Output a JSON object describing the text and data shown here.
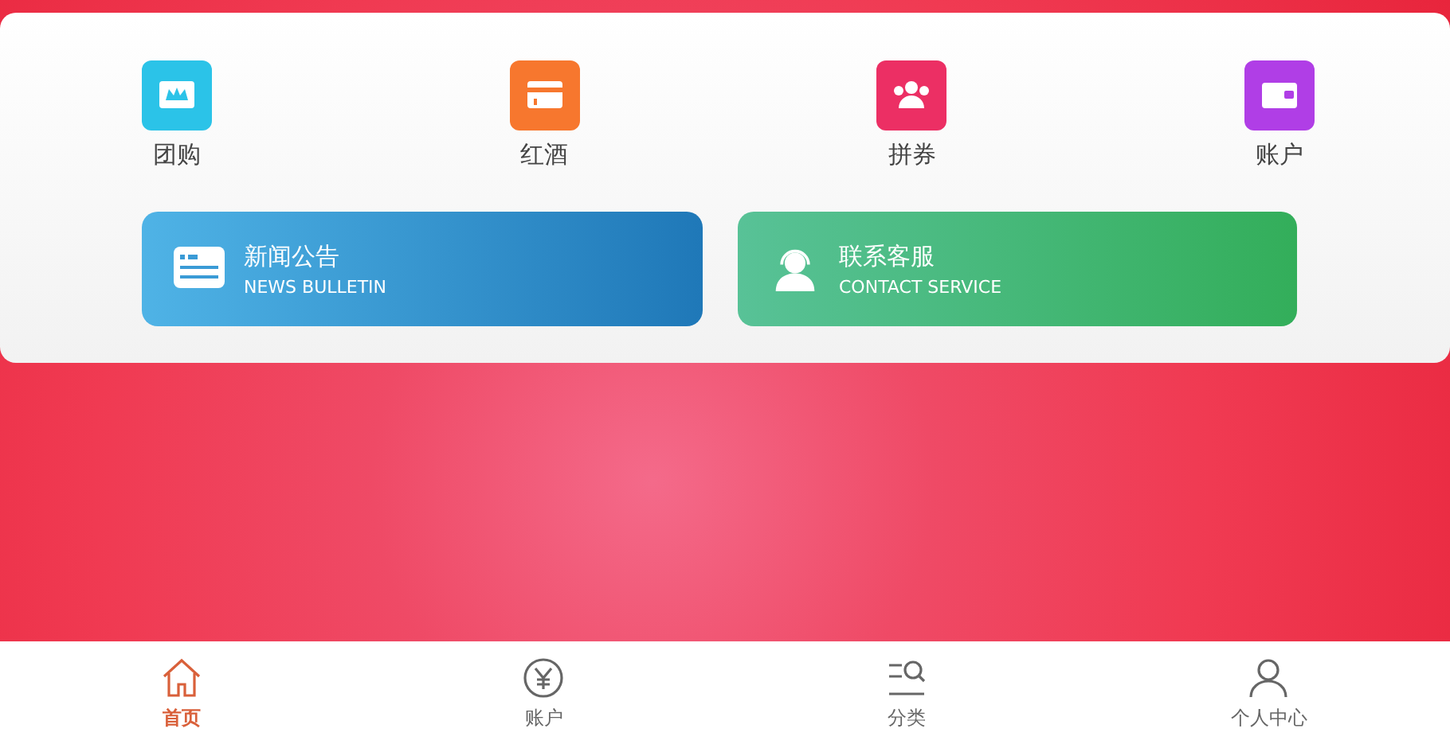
{
  "shortcuts": [
    {
      "label": "团购",
      "kind": "crown",
      "color": "#2bc3e8"
    },
    {
      "label": "红酒",
      "kind": "card",
      "color": "#f7772e"
    },
    {
      "label": "拼券",
      "kind": "people",
      "color": "#ec2f64"
    },
    {
      "label": "账户",
      "kind": "wallet",
      "color": "#b03ee6"
    }
  ],
  "banners": [
    {
      "kind": "news",
      "title": "新闻公告",
      "subtitle": "NEWS BULLETIN"
    },
    {
      "kind": "service",
      "title": "联系客服",
      "subtitle": "CONTACT SERVICE"
    }
  ],
  "tabbar": [
    {
      "label": "首页",
      "kind": "home",
      "selected": true
    },
    {
      "label": "账户",
      "kind": "yen",
      "selected": false
    },
    {
      "label": "分类",
      "kind": "category",
      "selected": false
    },
    {
      "label": "个人中心",
      "kind": "person",
      "selected": false
    }
  ]
}
